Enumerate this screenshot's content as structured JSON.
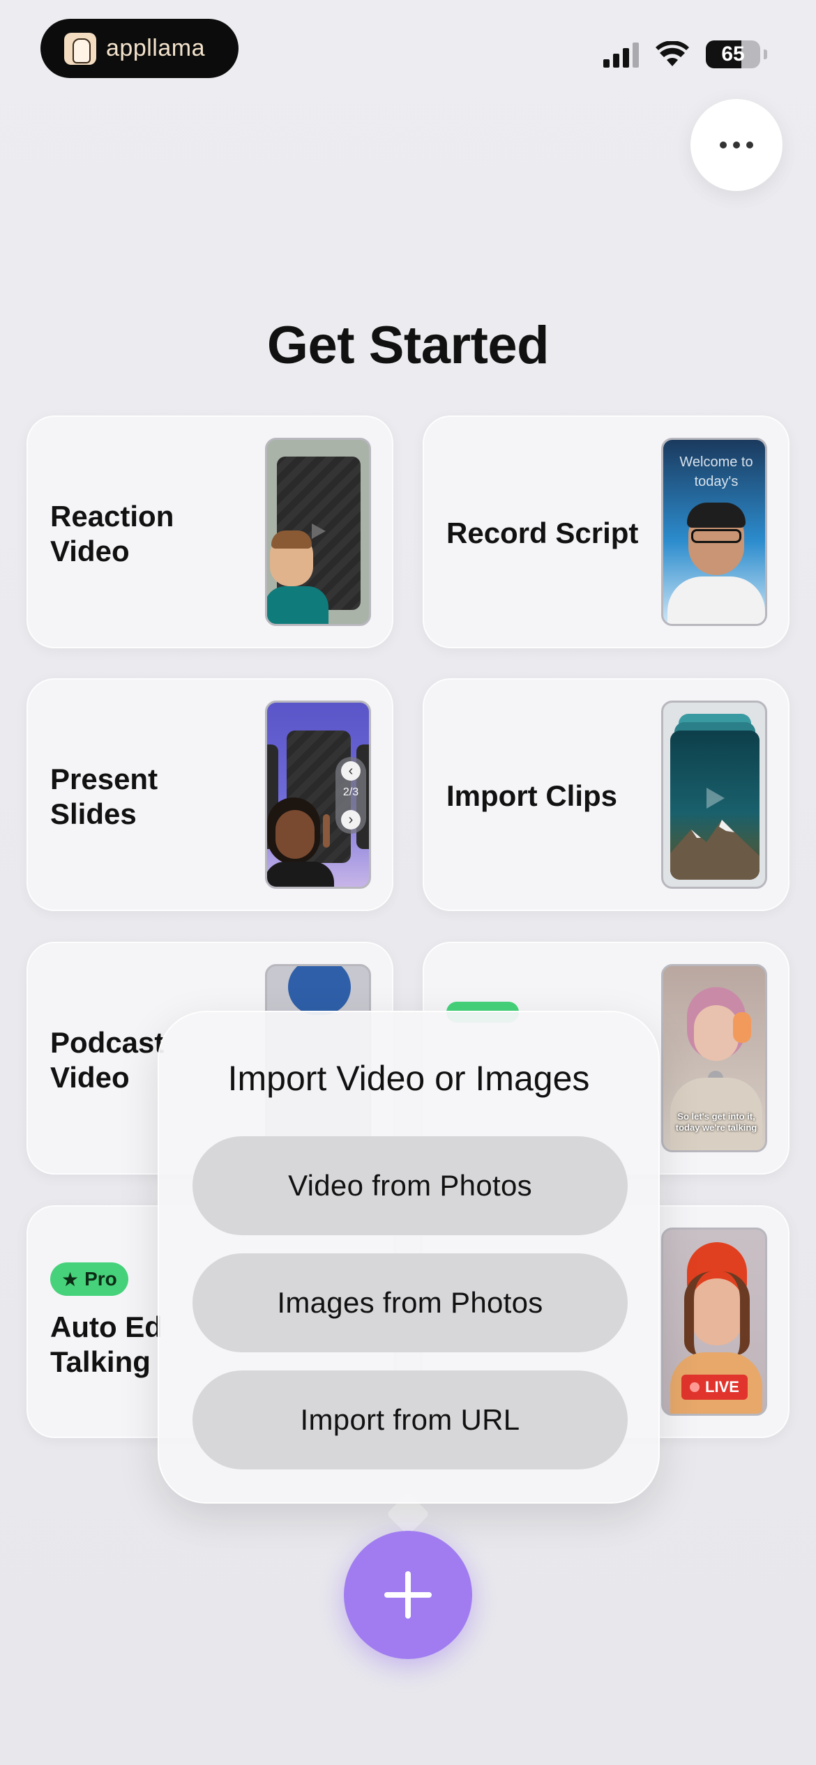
{
  "status_bar": {
    "brand_name": "appllama",
    "battery_level": "65"
  },
  "header": {
    "more_icon": "ellipsis-icon"
  },
  "title": "Get Started",
  "cards": [
    {
      "label_line1": "Reaction",
      "label_line2": "Video"
    },
    {
      "label": "Record Script",
      "thumb_text": "Welcome to today's"
    },
    {
      "label_line1": "Present",
      "label_line2": "Slides",
      "page_indicator": "2/3"
    },
    {
      "label": "Import Clips"
    },
    {
      "label_line1": "Podcast",
      "label_line2": "Video"
    },
    {
      "caption": "So let's get into it, today we're talking"
    },
    {
      "badge": "Pro",
      "label_line1": "Auto Ed",
      "label_line2": "Talking"
    },
    {
      "live_badge": "LIVE"
    }
  ],
  "popup": {
    "title": "Import Video or Images",
    "options": [
      "Video from Photos",
      "Images from Photos",
      "Import from URL"
    ]
  },
  "fab": {
    "icon": "plus-icon"
  },
  "colors": {
    "accent": "#a07cf0",
    "pro_green": "#46d27a",
    "live_red": "#e0342c"
  }
}
